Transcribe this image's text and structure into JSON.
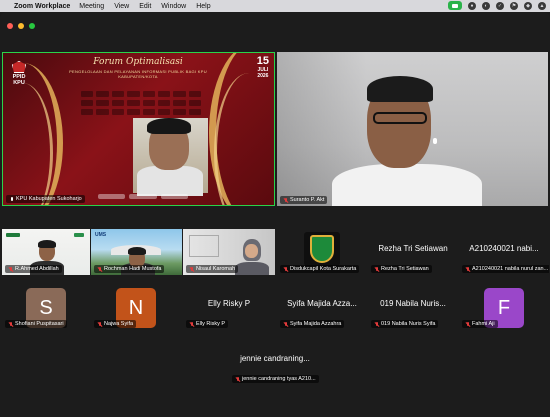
{
  "menubar": {
    "app_name": "Zoom Workplace",
    "items": [
      "Meeting",
      "View",
      "Edit",
      "Window",
      "Help"
    ]
  },
  "slide": {
    "title": "Forum Optimalisasi",
    "subtitle": "PENGELOLAAN DAN PELAYANAN INFORMASI PUBLIK BAGI KPU KABUPATEN/KOTA",
    "logo_text": "PPID KPU",
    "date_day": "15",
    "date_month": "JULI",
    "date_year": "2026"
  },
  "participants": {
    "kpu": "KPU Kabupaten Sukoharjo",
    "suranto": "Suranto P. Akt",
    "ahmed": "R.Ahmed Abdillah",
    "rochman": "Rochman Hadi Mustofa",
    "nisaul": "Nisaul Karomah",
    "disdukcapil": "Disdukcapil Kota Surakarta",
    "rezha_display": "Rezha Tri Setiawan",
    "rezha": "Rezha Tri Setiawan",
    "a2100_display": "A210240021 nabi...",
    "a2100": "A210240021 nabila nurul zan...",
    "shofiani": "Shofiani Puspitasari",
    "najwa": "Najwa Syifa",
    "elly_display": "Elly Risky P",
    "elly": "Elly Risky P",
    "syifa_display": "Syifa Majida Azza...",
    "syifa": "Syifa Majida Azzahra",
    "nabila_display": "019 Nabila Nuris...",
    "nabila": "019 Nabila Nuris Syifa",
    "fahmi": "Fahmi Aji",
    "jennie_display": "jennie candraning...",
    "jennie": "jennie candraning tyas A210..."
  },
  "avatars": {
    "shofiani": "S",
    "najwa": "N",
    "fahmi": "F"
  },
  "colors": {
    "active_speaker_border": "#2ad34a",
    "shofiani_avatar": "#8a6a58",
    "najwa_avatar": "#c2531a",
    "fahmi_avatar": "#9a47c9",
    "muted_icon": "#e23b3b"
  }
}
